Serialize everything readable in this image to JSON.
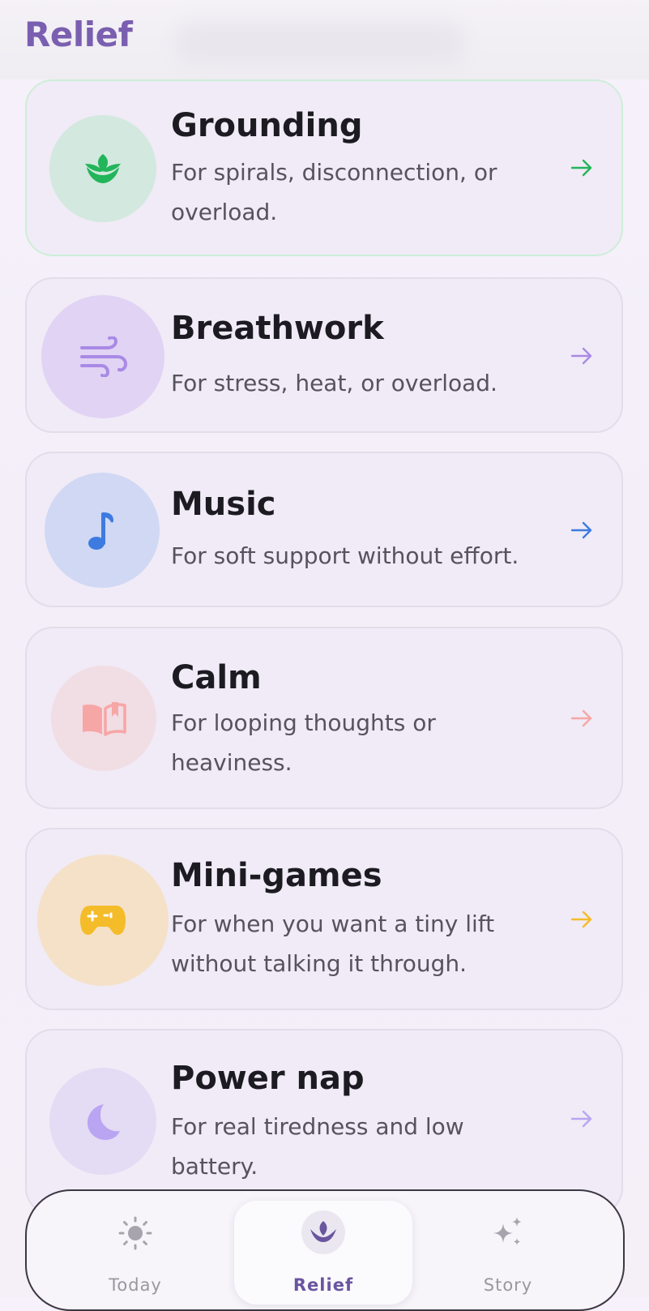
{
  "header": {
    "title": "Relief"
  },
  "cards": [
    {
      "title": "Grounding",
      "desc": "For spirals, disconnection, or overload.",
      "icon": "sprout-icon",
      "accent": "#22b55a",
      "circle_bg": "#d3e8de"
    },
    {
      "title": "Breathwork",
      "desc": "For stress, heat, or overload.",
      "icon": "wind-icon",
      "accent": "#a98ae6",
      "circle_bg": "#e1d3f4"
    },
    {
      "title": "Music",
      "desc": "For soft support without effort.",
      "icon": "music-note-icon",
      "accent": "#3d7be0",
      "circle_bg": "#d0d8f4"
    },
    {
      "title": "Calm",
      "desc": "For looping thoughts or heaviness.",
      "icon": "book-icon",
      "accent": "#f7a6a6",
      "circle_bg": "#f1dde4"
    },
    {
      "title": "Mini-games",
      "desc": "For when you want a tiny lift without talking it through.",
      "icon": "gamepad-icon",
      "accent": "#f5bc2a",
      "circle_bg": "#f4e1c8"
    },
    {
      "title": "Power nap",
      "desc": "For real tiredness and low battery.",
      "icon": "moon-icon",
      "accent": "#b9a5f2",
      "circle_bg": "#e4dbf5"
    }
  ],
  "nav": {
    "items": [
      {
        "label": "Today",
        "icon": "sun-icon"
      },
      {
        "label": "Relief",
        "icon": "lotus-icon"
      },
      {
        "label": "Story",
        "icon": "sparkles-icon"
      }
    ],
    "active_color": "#6a55a0"
  }
}
